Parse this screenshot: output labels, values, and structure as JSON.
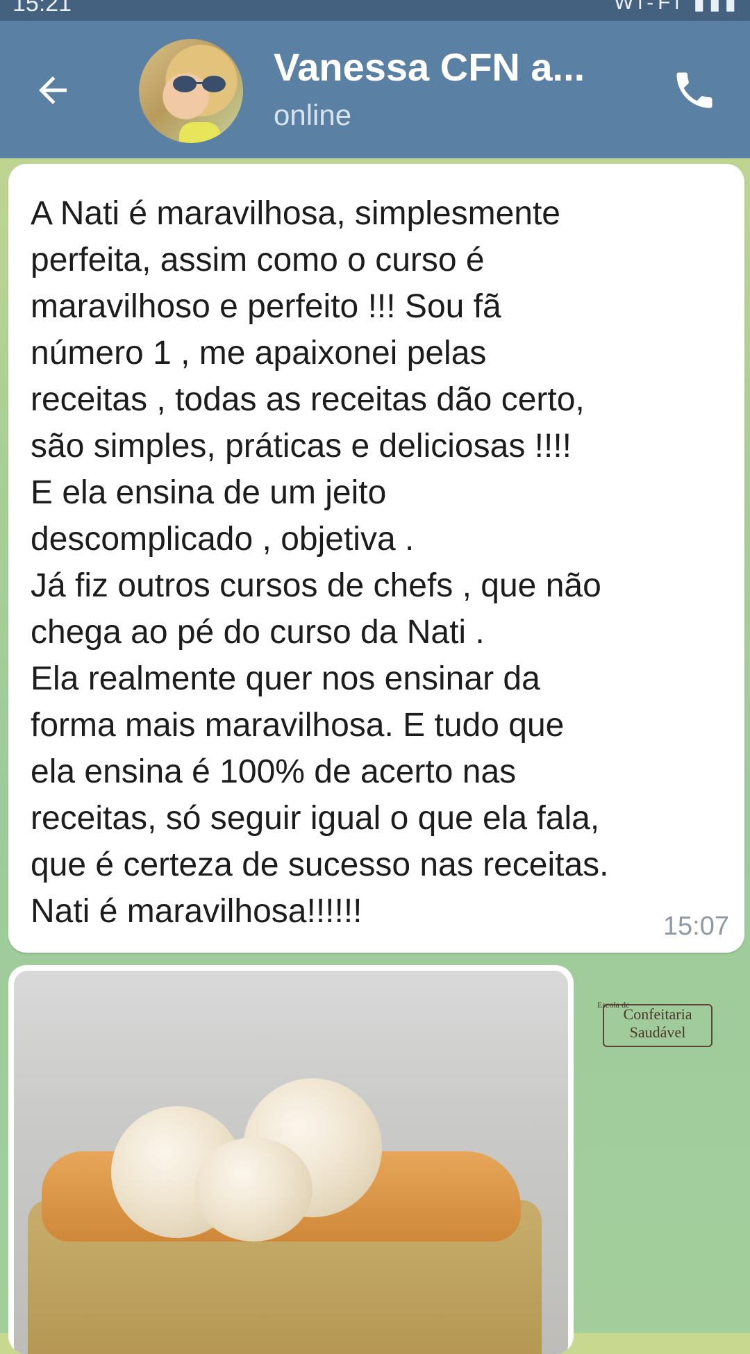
{
  "status_bar": {
    "time": "15:21",
    "right": "Wi-Fi  ▮▮▮"
  },
  "header": {
    "title": "Vanessa CFN a...",
    "status": "online"
  },
  "message": {
    "text": "A Nati é maravilhosa, simplesmente\nperfeita, assim como o curso é\nmaravilhoso e perfeito !!! Sou fã\nnúmero 1 , me apaixonei pelas\nreceitas , todas as receitas dão certo,\nsão simples,  práticas e deliciosas !!!!\nE ela ensina de um jeito\ndescomplicado , objetiva .\nJá fiz outros cursos de chefs , que não\nchega ao pé do curso da Nati .\nEla realmente quer nos ensinar da\nforma mais maravilhosa. E tudo que\nela ensina é 100% de acerto nas\nreceitas,  só seguir igual o que ela fala,\nque é certeza de sucesso nas receitas.\nNati é maravilhosa!!!!!!",
    "time": "15:07"
  },
  "logo": {
    "small": "Escola de",
    "line1": "Confeitaria",
    "line2": "Saudável"
  },
  "icons": {
    "back": "arrow-left-icon",
    "call": "phone-icon"
  },
  "colors": {
    "header": "#5a80a3",
    "status_bar": "#44617f",
    "bubble": "#ffffff"
  }
}
